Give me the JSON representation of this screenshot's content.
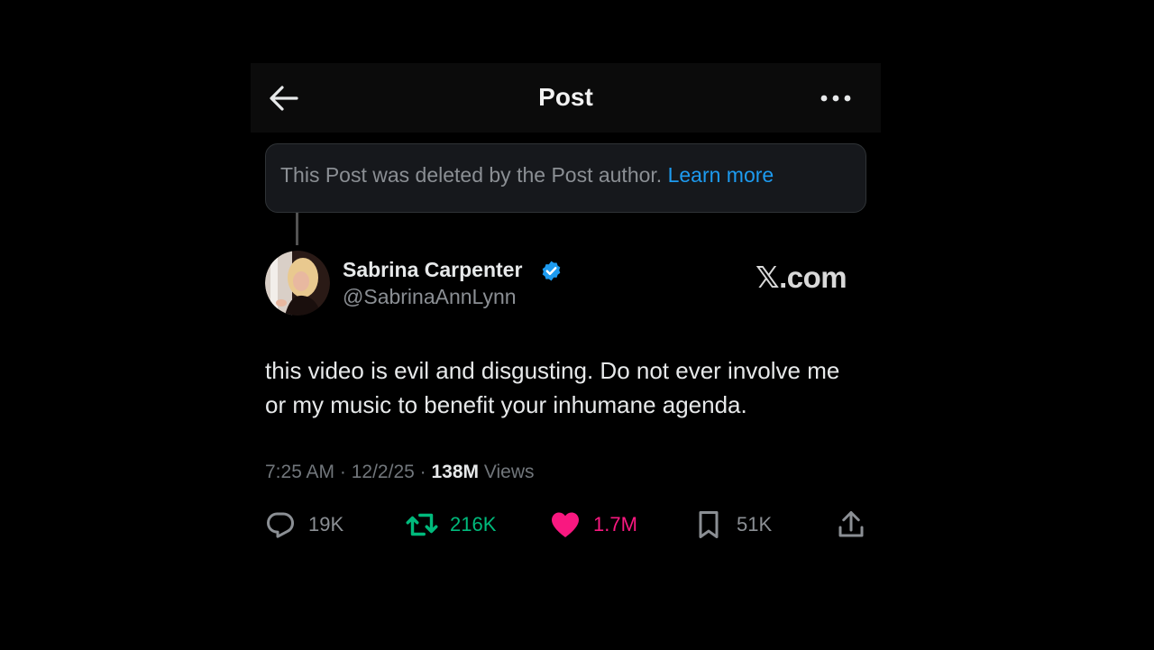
{
  "header": {
    "title": "Post"
  },
  "notice": {
    "text": "This Post was deleted by the Post author.",
    "link": "Learn more"
  },
  "author": {
    "name": "Sabrina Carpenter",
    "handle": "@SabrinaAnnLynn",
    "verified": true
  },
  "watermark": "𝕏.com",
  "post": {
    "text": "this video is evil and disgusting. Do not ever involve me or my music to benefit your inhumane agenda.",
    "time": "7:25 AM",
    "date": "12/2/25",
    "views_count": "138M",
    "views_label": "Views"
  },
  "actions": {
    "replies": "19K",
    "reposts": "216K",
    "likes": "1.7M",
    "bookmarks": "51K"
  },
  "icons": [
    "back-arrow-icon",
    "more-icon",
    "verified-badge-icon",
    "reply-icon",
    "repost-icon",
    "heart-icon",
    "bookmark-icon",
    "share-icon"
  ],
  "colors": {
    "link": "#1d9bf0",
    "verified": "#1d9bf0",
    "repost": "#00ba7c",
    "like": "#f91880",
    "muted": "#71767b",
    "background": "#000000"
  }
}
